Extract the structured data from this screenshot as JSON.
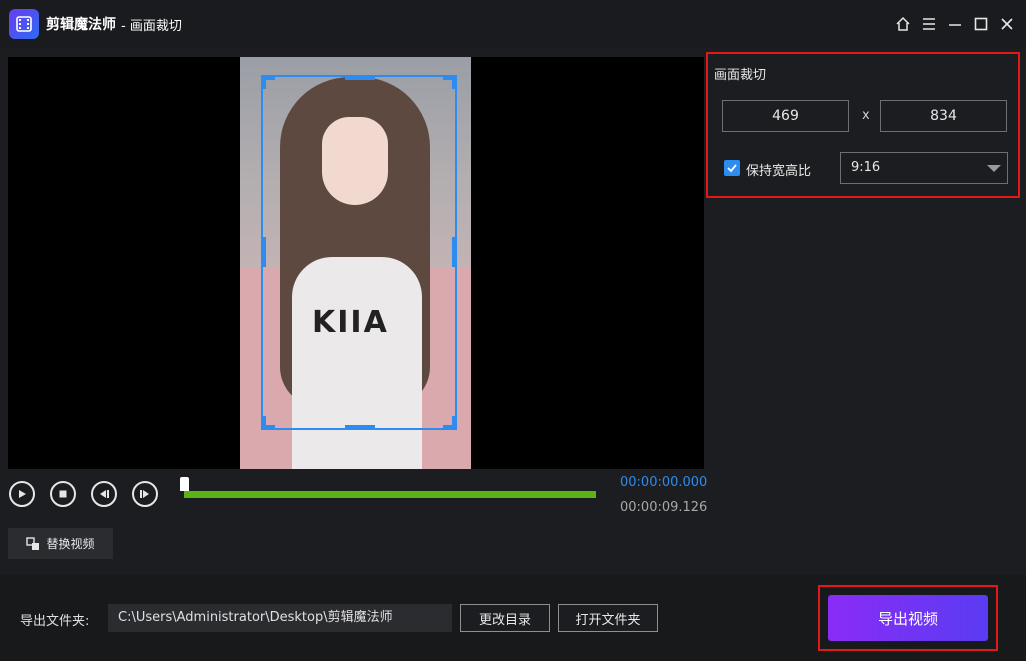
{
  "window": {
    "app_name": "剪辑魔法师",
    "separator": "-",
    "title": "画面裁切"
  },
  "player": {
    "shirt_text": "KIIA",
    "time_current": "00:00:00.000",
    "time_total": "00:00:09.126",
    "progress": 0,
    "replace_label": "替换视频"
  },
  "crop_panel": {
    "title": "画面裁切",
    "width": "469",
    "times": "x",
    "height": "834",
    "keep_ratio_label": "保持宽高比",
    "keep_ratio_checked": true,
    "ratio_value": "9:16"
  },
  "bottom": {
    "output_label": "导出文件夹:",
    "output_path": "C:\\Users\\Administrator\\Desktop\\剪辑魔法师",
    "change_dir_label": "更改目录",
    "open_folder_label": "打开文件夹",
    "export_label": "导出视频"
  },
  "colors": {
    "accent_blue": "#2d8cf0",
    "progress_green": "#5bb318",
    "highlight_red": "#e0191b",
    "export_gradient_start": "#8a2cf6",
    "export_gradient_end": "#5a3cf2"
  }
}
